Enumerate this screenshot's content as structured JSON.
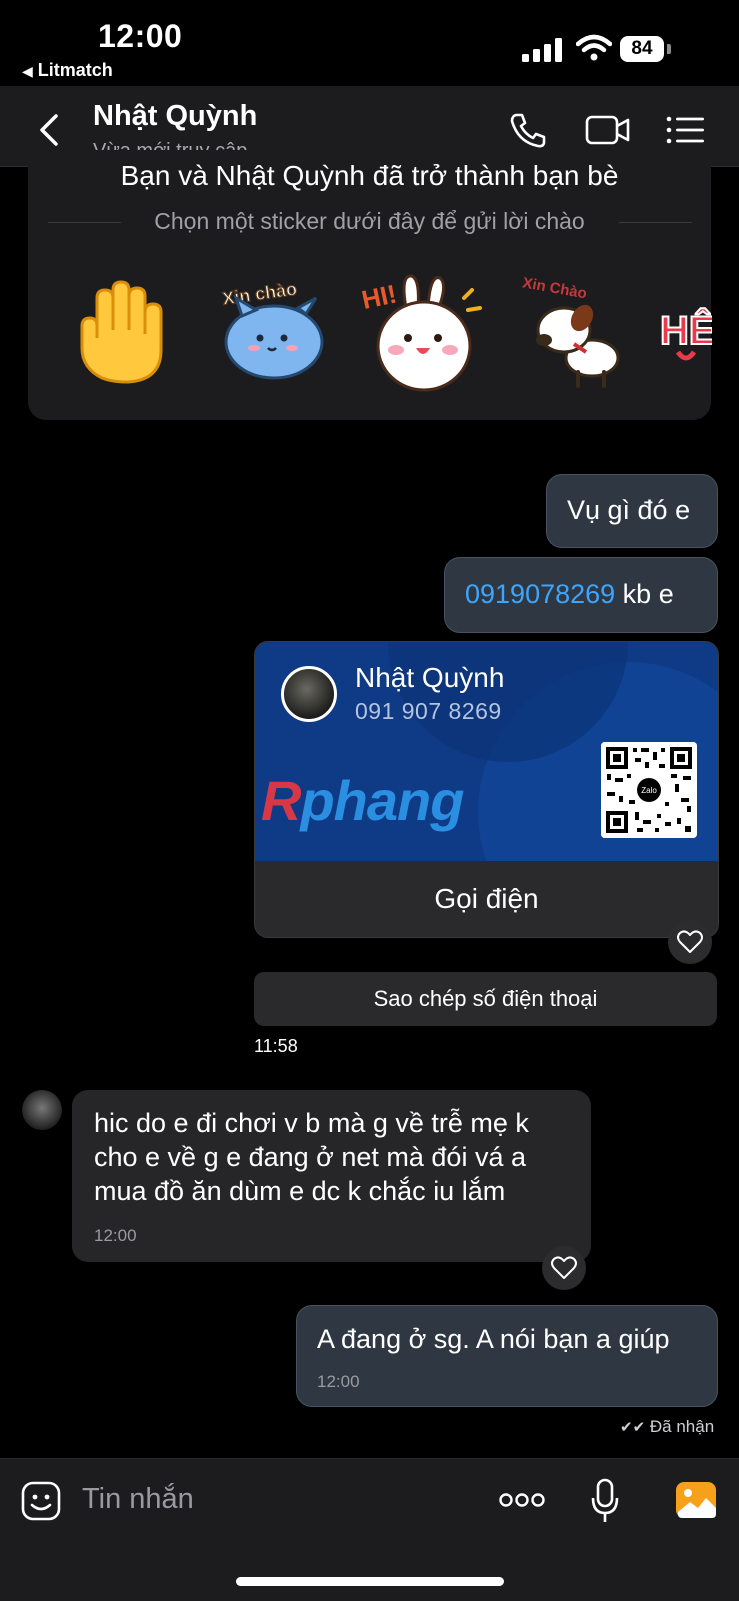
{
  "status": {
    "time": "12:00",
    "back_app": "Litmatch",
    "battery": "84"
  },
  "header": {
    "name": "Nhật Quỳnh",
    "presence": "Vừa mới truy cập"
  },
  "friend_notice": {
    "title": "Bạn và Nhật Quỳnh đã trở thành bạn bè",
    "subtitle": "Chọn một sticker dưới đây để gửi lời chào",
    "stickers": [
      {
        "icon": "waving-hand-icon"
      },
      {
        "icon": "blue-cat-sticker",
        "caption": "Xin chào"
      },
      {
        "icon": "bunny-sticker",
        "caption": "HI!"
      },
      {
        "icon": "dog-sticker",
        "caption": "Xin Chào"
      },
      {
        "icon": "hello-sticker",
        "caption": "HÊ"
      }
    ]
  },
  "messages": {
    "m1": {
      "text": "Vụ gì đó e"
    },
    "m2": {
      "phone": "0919078269",
      "text": " kb e"
    },
    "contact": {
      "name": "Nhật Quỳnh",
      "phone": "091 907 8269",
      "logo_first": "R",
      "logo_rest": "phang",
      "qr_label": "Zalo",
      "call_label": "Gọi điện"
    },
    "copy_label": "Sao chép số điện thoại",
    "time_1": "11:58",
    "m3": {
      "line1": "hic do e đi chơi v b mà g về trễ mẹ k",
      "line2": "cho e về g e đang ở net mà đói vá a",
      "line3": "mua đồ ăn dùm e dc k chắc iu lắm",
      "time": "12:00"
    },
    "m4": {
      "text": "A đang ở sg. A nói bạn a giúp",
      "time": "12:00"
    },
    "delivered": "Đã nhận"
  },
  "input": {
    "placeholder": "Tin nhắn"
  },
  "colors": {
    "link": "#3ba6ff",
    "header_bg": "#1c1c1e",
    "bubble_out": "#2f3742",
    "bubble_in": "#262628",
    "card_blue": "#0e3a86",
    "accent_orange": "#f7a01a"
  }
}
